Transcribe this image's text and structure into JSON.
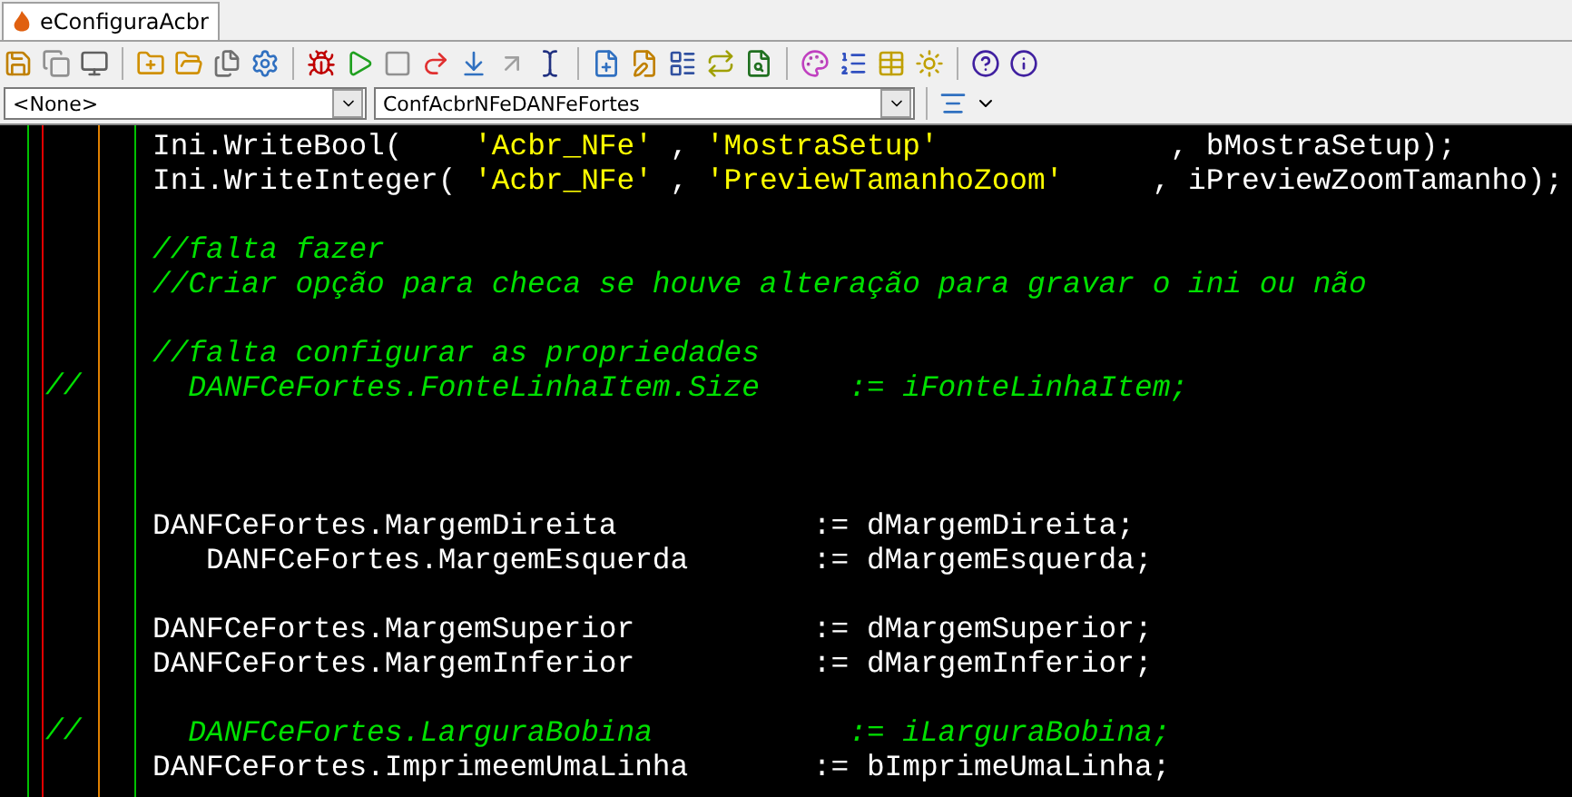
{
  "tab": {
    "title": "eConfiguraAcbr",
    "selected": true
  },
  "selectors": [
    {
      "value": "<None>"
    },
    {
      "value": "ConfAcbrNFeDANFeFortes"
    }
  ],
  "code_lines": [
    {
      "kind": "text",
      "segments": [
        {
          "kind": "code",
          "text": "Ini.WriteBool(    "
        },
        {
          "kind": "string",
          "text": "'Acbr_NFe'"
        },
        {
          "kind": "code",
          "text": " , "
        },
        {
          "kind": "string",
          "text": "'MostraSetup'"
        },
        {
          "kind": "code",
          "text": "             , bMostraSetup);"
        }
      ]
    },
    {
      "kind": "text",
      "segments": [
        {
          "kind": "code",
          "text": "Ini.WriteInteger( "
        },
        {
          "kind": "string",
          "text": "'Acbr_NFe'"
        },
        {
          "kind": "code",
          "text": " , "
        },
        {
          "kind": "string",
          "text": "'PreviewTamanhoZoom'"
        },
        {
          "kind": "code",
          "text": "     , iPreviewZoomTamanho);"
        }
      ]
    },
    {
      "kind": "blank"
    },
    {
      "kind": "text",
      "segments": [
        {
          "kind": "comment",
          "text": "//falta fazer"
        }
      ]
    },
    {
      "kind": "text",
      "segments": [
        {
          "kind": "comment",
          "text": "//Criar opção para checa se houve alteração para gravar o ini ou não"
        }
      ]
    },
    {
      "kind": "blank"
    },
    {
      "kind": "text",
      "segments": [
        {
          "kind": "comment",
          "text": "//falta configurar as propriedades"
        }
      ]
    },
    {
      "kind": "text",
      "gutter": "//",
      "segments": [
        {
          "kind": "comment",
          "text": "  DANFCeFortes.FonteLinhaItem.Size     := iFonteLinhaItem;"
        }
      ]
    },
    {
      "kind": "blank"
    },
    {
      "kind": "blank"
    },
    {
      "kind": "blank"
    },
    {
      "kind": "text",
      "segments": [
        {
          "kind": "code",
          "text": "DANFCeFortes.MargemDireita           := dMargemDireita;"
        }
      ]
    },
    {
      "kind": "text",
      "segments": [
        {
          "kind": "code",
          "text": "   DANFCeFortes.MargemEsquerda       := dMargemEsquerda;"
        }
      ]
    },
    {
      "kind": "blank"
    },
    {
      "kind": "text",
      "segments": [
        {
          "kind": "code",
          "text": "DANFCeFortes.MargemSuperior          := dMargemSuperior;"
        }
      ]
    },
    {
      "kind": "text",
      "segments": [
        {
          "kind": "code",
          "text": "DANFCeFortes.MargemInferior          := dMargemInferior;"
        }
      ]
    },
    {
      "kind": "blank"
    },
    {
      "kind": "text",
      "gutter": "//",
      "segments": [
        {
          "kind": "comment",
          "text": "  DANFCeFortes.LarguraBobina           := iLarguraBobina;"
        }
      ]
    },
    {
      "kind": "text",
      "segments": [
        {
          "kind": "code",
          "text": "DANFCeFortes.ImprimeemUmaLinha       := bImprimeUmaLinha;"
        }
      ]
    }
  ]
}
